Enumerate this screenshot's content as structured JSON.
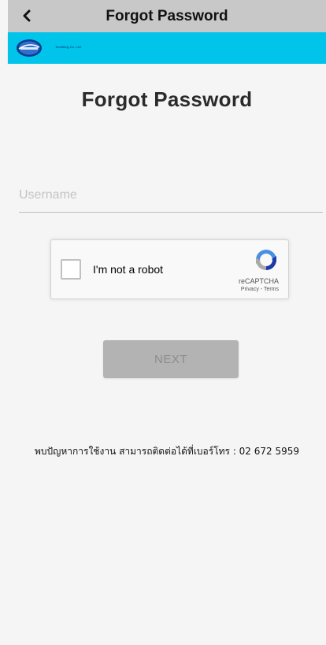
{
  "navbar": {
    "back_icon": "chevron-left-icon",
    "title": "Forgot Password"
  },
  "brand": {
    "logo_icon": "company-logo",
    "logo_text": "Tunothing Co., Ltd.",
    "band_color": "#00c4ea"
  },
  "form": {
    "title": "Forgot Password",
    "username_placeholder": "Username",
    "username_value": "",
    "next_label": "NEXT"
  },
  "recaptcha": {
    "label": "I'm not a robot",
    "brand": "reCAPTCHA",
    "privacy_label": "Privacy",
    "separator": " - ",
    "terms_label": "Terms",
    "checked": false
  },
  "support": {
    "text": "พบปัญหาการใช้งาน สามารถติดต่อได้ที่เบอร์โทร : 02 672 5959"
  }
}
